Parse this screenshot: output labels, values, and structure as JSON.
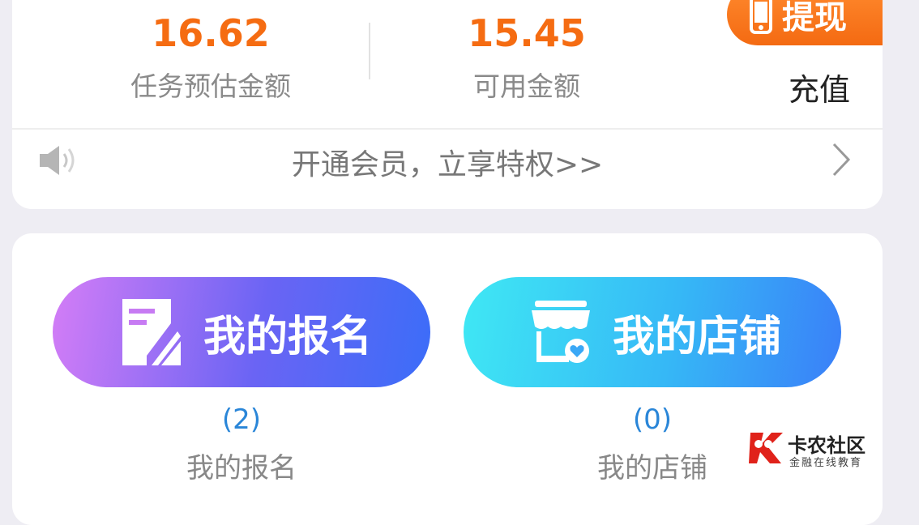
{
  "summary": {
    "task_estimate_amount": "16.62",
    "task_estimate_label": "任务预估金额",
    "available_amount": "15.45",
    "available_label": "可用金额",
    "withdraw_label": "提现",
    "recharge_label": "充值"
  },
  "notice": {
    "text": "开通会员，立享特权>>"
  },
  "actions": {
    "signup_button_label": "我的报名",
    "signup_count": "(2)",
    "signup_label": "我的报名",
    "shop_button_label": "我的店铺",
    "shop_count": "(0)",
    "shop_label": "我的店铺"
  },
  "watermark": {
    "title": "卡农社区",
    "subtitle": "金融在线教育"
  },
  "colors": {
    "accent_orange": "#f56c12",
    "count_blue": "#2a86d8"
  },
  "icons": [
    "phone-icon",
    "speaker-icon",
    "chevron-right-icon",
    "form-edit-icon",
    "shop-icon"
  ]
}
